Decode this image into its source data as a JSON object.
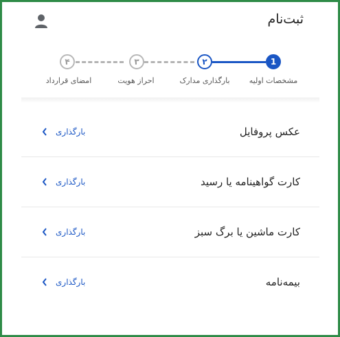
{
  "header": {
    "title": "ثبت‌نام"
  },
  "stepper": {
    "steps": [
      {
        "number": "1",
        "label": "مشخصات اولیه",
        "state": "done"
      },
      {
        "number": "۲",
        "label": "بارگذاری مدارک",
        "state": "current"
      },
      {
        "number": "۳",
        "label": "احراز هویت",
        "state": "todo"
      },
      {
        "number": "۴",
        "label": "امضای قرارداد",
        "state": "todo"
      }
    ]
  },
  "documents": [
    {
      "title": "عکس پروفایل",
      "action": "بارگذاری"
    },
    {
      "title": "کارت گواهینامه یا رسید",
      "action": "بارگذاری"
    },
    {
      "title": "کارت ماشین یا برگ سبز",
      "action": "بارگذاری"
    },
    {
      "title": "بیمه‌نامه",
      "action": "بارگذاری"
    }
  ],
  "colors": {
    "accent": "#1a56c4",
    "frame": "#2e8b47",
    "inactive": "#b7b7b7"
  }
}
